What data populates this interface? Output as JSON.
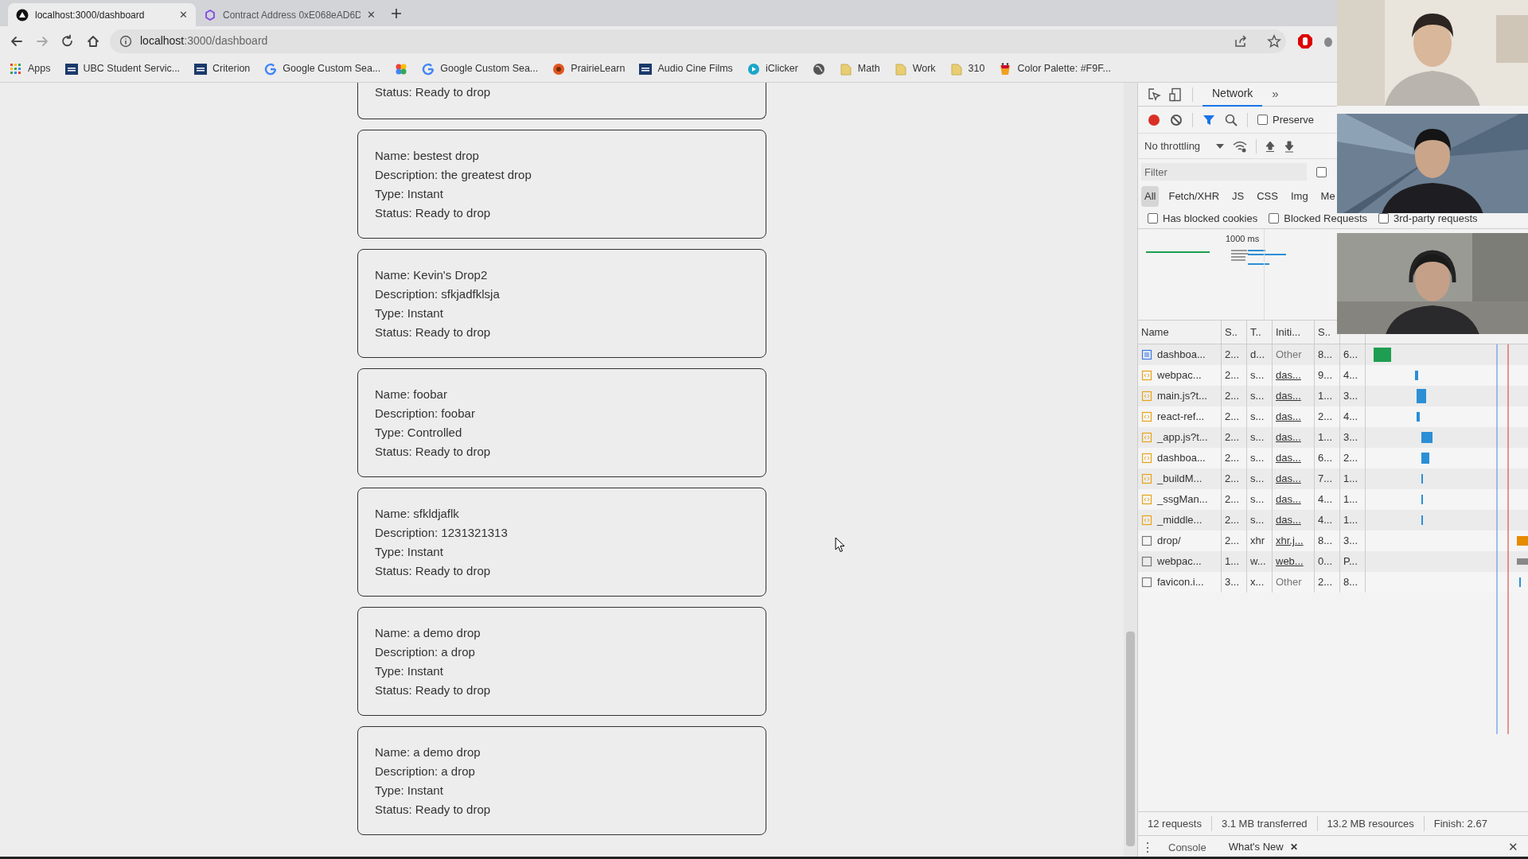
{
  "browser": {
    "tabs": [
      {
        "title": "localhost:3000/dashboard",
        "selected": true
      },
      {
        "title": "Contract Address 0xE068eAD6D",
        "selected": false
      }
    ],
    "address": {
      "host": "localhost",
      "path": ":3000/dashboard"
    },
    "forward_disabled": true,
    "bookmarks": [
      {
        "kind": "apps",
        "label": "Apps"
      },
      {
        "kind": "ubc",
        "label": "UBC Student Servic..."
      },
      {
        "kind": "ubc",
        "label": "Criterion"
      },
      {
        "kind": "google",
        "label": "Google Custom Sea..."
      },
      {
        "kind": "pinwheel"
      },
      {
        "kind": "google",
        "label": "Google Custom Sea..."
      },
      {
        "kind": "prairie",
        "label": "PrairieLearn"
      },
      {
        "kind": "ubc",
        "label": "Audio Cine Films"
      },
      {
        "kind": "iclicker",
        "label": "iClicker"
      },
      {
        "kind": "globe"
      },
      {
        "kind": "folder",
        "label": "Math"
      },
      {
        "kind": "folder",
        "label": "Work"
      },
      {
        "kind": "folder",
        "label": "310"
      },
      {
        "kind": "palette",
        "label": "Color Palette: #F9F..."
      }
    ]
  },
  "drops": [
    {
      "lines": [
        "Status: Ready to drop"
      ],
      "partial": true
    },
    {
      "lines": [
        "Name: bestest drop",
        "Description: the greatest drop",
        "Type: Instant",
        "Status: Ready to drop"
      ],
      "partial": false
    },
    {
      "lines": [
        "Name: Kevin's Drop2",
        "Description: sfkjadfklsja",
        "Type: Instant",
        "Status: Ready to drop"
      ],
      "partial": false
    },
    {
      "lines": [
        "Name: foobar",
        "Description: foobar",
        "Type: Controlled",
        "Status: Ready to drop"
      ],
      "partial": false
    },
    {
      "lines": [
        "Name: sfkldjaflk",
        "Description: 1231321313",
        "Type: Instant",
        "Status: Ready to drop"
      ],
      "partial": false
    },
    {
      "lines": [
        "Name: a demo drop",
        "Description: a drop",
        "Type: Instant",
        "Status: Ready to drop"
      ],
      "partial": false
    },
    {
      "lines": [
        "Name: a demo drop",
        "Description: a drop",
        "Type: Instant",
        "Status: Ready to drop"
      ],
      "partial": false
    }
  ],
  "devtools": {
    "tabs": [
      {
        "label": "Network",
        "selected": true
      }
    ],
    "more": "»",
    "preserve": {
      "label": "Preserve",
      "checked": false
    },
    "throttling": "No throttling",
    "filter": {
      "placeholder": "Filter",
      "invert_checked": false
    },
    "types": [
      {
        "label": "All",
        "selected": true
      },
      {
        "label": "Fetch/XHR",
        "selected": false
      },
      {
        "label": "JS",
        "selected": false
      },
      {
        "label": "CSS",
        "selected": false
      },
      {
        "label": "Img",
        "selected": false
      },
      {
        "label": "Me",
        "selected": false
      }
    ],
    "options": [
      {
        "label": "Has blocked cookies",
        "checked": false
      },
      {
        "label": "Blocked Requests",
        "checked": false
      },
      {
        "label": "3rd-party requests",
        "checked": false
      }
    ],
    "overview_label": "1000 ms",
    "columns": [
      "Name",
      "S..",
      "T..",
      "Initi...",
      "S.."
    ],
    "rows": [
      {
        "kind": "document",
        "cells": [
          "dashboa...",
          "2...",
          "d...",
          "Other",
          "8...",
          "6..."
        ],
        "initiator_link": false
      },
      {
        "kind": "script",
        "cells": [
          "webpac...",
          "2...",
          "s...",
          "das...",
          "9...",
          "4..."
        ],
        "initiator_link": true
      },
      {
        "kind": "script",
        "cells": [
          "main.js?t...",
          "2...",
          "s...",
          "das...",
          "1...",
          "3..."
        ],
        "initiator_link": true
      },
      {
        "kind": "script",
        "cells": [
          "react-ref...",
          "2...",
          "s...",
          "das...",
          "2...",
          "4..."
        ],
        "initiator_link": true
      },
      {
        "kind": "script",
        "cells": [
          "_app.js?t...",
          "2...",
          "s...",
          "das...",
          "1...",
          "3..."
        ],
        "initiator_link": true
      },
      {
        "kind": "script",
        "cells": [
          "dashboa...",
          "2...",
          "s...",
          "das...",
          "6...",
          "2..."
        ],
        "initiator_link": true
      },
      {
        "kind": "script",
        "cells": [
          "_buildM...",
          "2...",
          "s...",
          "das...",
          "7...",
          "1..."
        ],
        "initiator_link": true
      },
      {
        "kind": "script",
        "cells": [
          "_ssgMan...",
          "2...",
          "s...",
          "das...",
          "4...",
          "1..."
        ],
        "initiator_link": true
      },
      {
        "kind": "script",
        "cells": [
          "_middle...",
          "2...",
          "s...",
          "das...",
          "4...",
          "1..."
        ],
        "initiator_link": true
      },
      {
        "kind": "other",
        "cells": [
          "drop/",
          "2...",
          "xhr",
          "xhr.j...",
          "8...",
          "3..."
        ],
        "initiator_link": true
      },
      {
        "kind": "other",
        "cells": [
          "webpac...",
          "1...",
          "w...",
          "web...",
          "0...",
          "P..."
        ],
        "initiator_link": true
      },
      {
        "kind": "other",
        "cells": [
          "favicon.i...",
          "3...",
          "x...",
          "Other",
          "2...",
          "8..."
        ],
        "initiator_link": false
      }
    ],
    "summary": [
      "12 requests",
      "3.1 MB transferred",
      "13.2 MB resources",
      "Finish: 2.67"
    ],
    "drawer_tabs": [
      {
        "label": "Console",
        "selected": false,
        "closable": false
      },
      {
        "label": "What's New",
        "selected": true,
        "closable": true
      }
    ],
    "drawer_menu": "⋮",
    "drawer_close": "✕",
    "tab_close": "✕"
  }
}
